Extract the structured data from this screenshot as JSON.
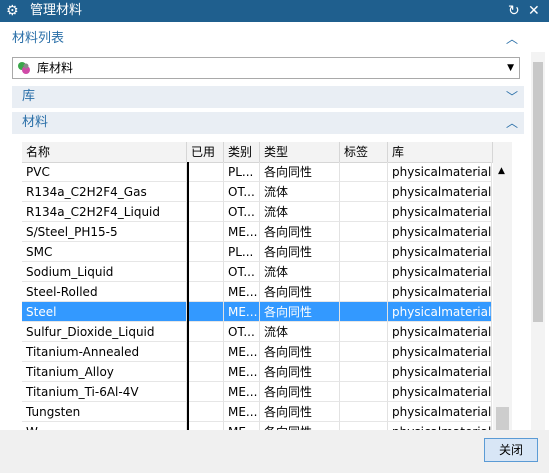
{
  "window": {
    "title": "管理材料"
  },
  "sections": {
    "list_title": "材料列表",
    "library_title": "库",
    "materials_title": "材料"
  },
  "dropdown": {
    "value": "库材料"
  },
  "table": {
    "columns": [
      "名称",
      "已用",
      "类别",
      "类型",
      "标签",
      "库"
    ],
    "rows": [
      {
        "name": "PVC",
        "used": "",
        "category": "PL...",
        "type": "各向同性",
        "tag": "",
        "lib": "physicalmateriallib"
      },
      {
        "name": "R134a_C2H2F4_Gas",
        "used": "",
        "category": "OT...",
        "type": "流体",
        "tag": "",
        "lib": "physicalmateriallib"
      },
      {
        "name": "R134a_C2H2F4_Liquid",
        "used": "",
        "category": "OT...",
        "type": "流体",
        "tag": "",
        "lib": "physicalmateriallib"
      },
      {
        "name": "S/Steel_PH15-5",
        "used": "",
        "category": "ME...",
        "type": "各向同性",
        "tag": "",
        "lib": "physicalmateriallib"
      },
      {
        "name": "SMC",
        "used": "",
        "category": "PL...",
        "type": "各向同性",
        "tag": "",
        "lib": "physicalmateriallib"
      },
      {
        "name": "Sodium_Liquid",
        "used": "",
        "category": "OT...",
        "type": "流体",
        "tag": "",
        "lib": "physicalmateriallib"
      },
      {
        "name": "Steel-Rolled",
        "used": "",
        "category": "ME...",
        "type": "各向同性",
        "tag": "",
        "lib": "physicalmateriallib"
      },
      {
        "name": "Steel",
        "used": "",
        "category": "ME...",
        "type": "各向同性",
        "tag": "",
        "lib": "physicalmateriallib"
      },
      {
        "name": "Sulfur_Dioxide_Liquid",
        "used": "",
        "category": "OT...",
        "type": "流体",
        "tag": "",
        "lib": "physicalmateriallib"
      },
      {
        "name": "Titanium-Annealed",
        "used": "",
        "category": "ME...",
        "type": "各向同性",
        "tag": "",
        "lib": "physicalmateriallib"
      },
      {
        "name": "Titanium_Alloy",
        "used": "",
        "category": "ME...",
        "type": "各向同性",
        "tag": "",
        "lib": "physicalmateriallib"
      },
      {
        "name": "Titanium_Ti-6Al-4V",
        "used": "",
        "category": "ME...",
        "type": "各向同性",
        "tag": "",
        "lib": "physicalmateriallib"
      },
      {
        "name": "Tungsten",
        "used": "",
        "category": "ME...",
        "type": "各向同性",
        "tag": "",
        "lib": "physicalmateriallib"
      },
      {
        "name": "W...",
        "used": "",
        "category": "ME...",
        "type": "各向同性",
        "tag": "",
        "lib": "physicalmateriallib"
      }
    ],
    "selected_index": 7
  },
  "footer": {
    "close_label": "关闭"
  },
  "icons": {
    "title": "gear-icon",
    "reset": "reset-icon",
    "close": "close-icon"
  },
  "colors": {
    "titlebar": "#1f5f8e",
    "selection": "#3399ff",
    "section_text": "#2a6fa8"
  }
}
